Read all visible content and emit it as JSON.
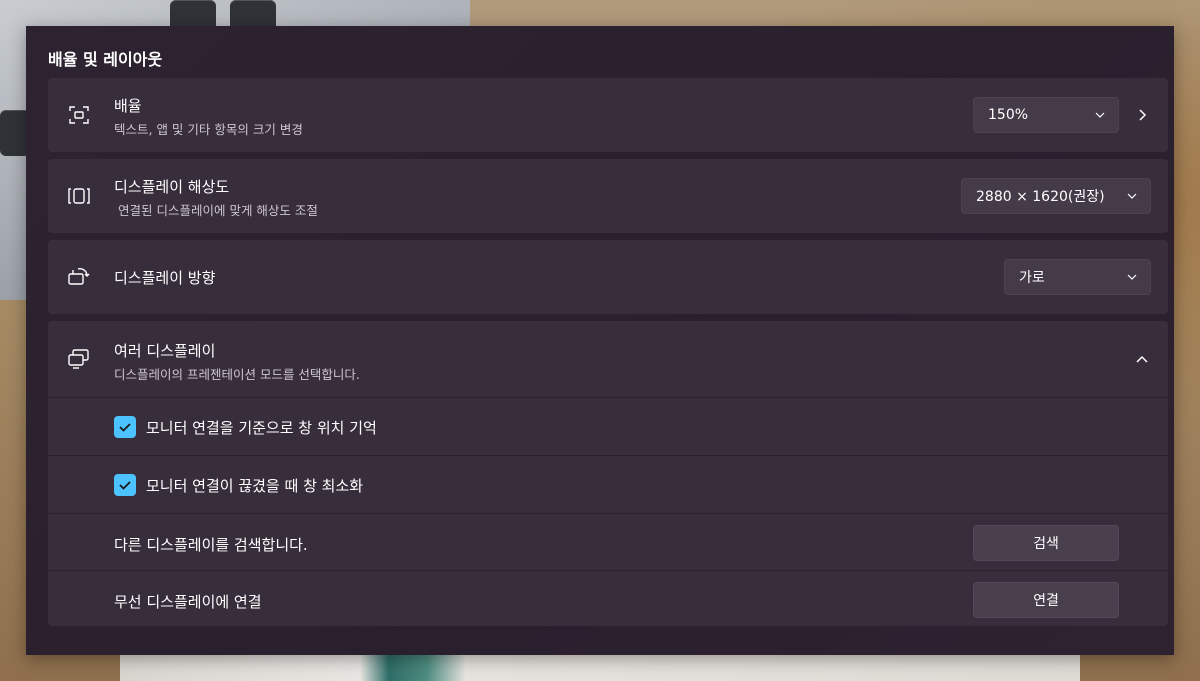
{
  "section": {
    "title": "배율 및 레이아웃"
  },
  "scale": {
    "title": "배율",
    "subtitle": "텍스트, 앱 및 기타 항목의 크기 변경",
    "value": "150%"
  },
  "resolution": {
    "title": "디스플레이 해상도",
    "subtitle": "연결된 디스플레이에 맞게 해상도 조절",
    "value": "2880 × 1620(권장)"
  },
  "orientation": {
    "title": "디스플레이 방향",
    "value": "가로"
  },
  "multiple_displays": {
    "title": "여러 디스플레이",
    "subtitle": "디스플레이의 프레젠테이션 모드를 선택합니다.",
    "expanded": true,
    "options": [
      {
        "label": "모니터 연결을 기준으로 창 위치 기억",
        "checked": true
      },
      {
        "label": "모니터 연결이 끊겼을 때 창 최소화",
        "checked": true
      }
    ],
    "detect": {
      "label": "다른 디스플레이를 검색합니다.",
      "button": "검색"
    },
    "wireless": {
      "label": "무선 디스플레이에 연결",
      "button": "연결"
    }
  },
  "colors": {
    "accent": "#4cc2ff",
    "card": "#382d3b",
    "panel": "#2a1f2e"
  }
}
